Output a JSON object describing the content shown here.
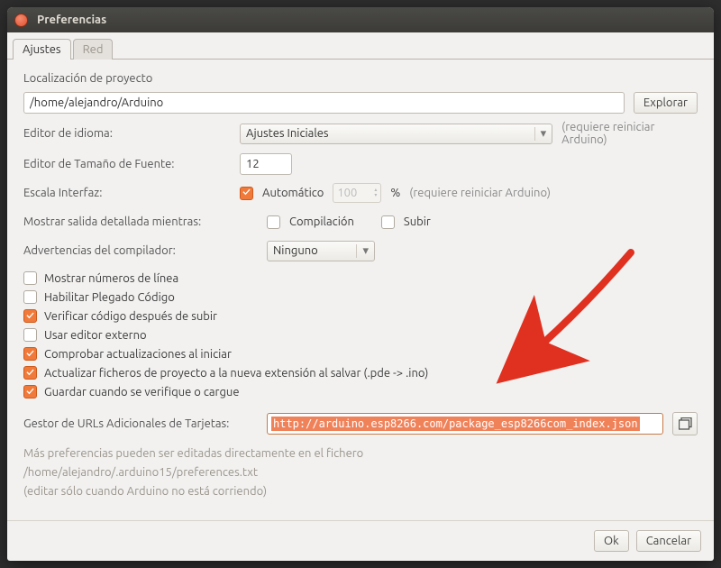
{
  "window": {
    "title": "Preferencias"
  },
  "tabs": {
    "active": "Ajustes",
    "other": "Red"
  },
  "project": {
    "label": "Localización de proyecto",
    "value": "/home/alejandro/Arduino",
    "browse": "Explorar"
  },
  "language": {
    "label": "Editor de idioma:",
    "value": "Ajustes Iniciales",
    "hint": "(requiere reiniciar Arduino)"
  },
  "fontsize": {
    "label": "Editor de Tamaño de Fuente:",
    "value": "12"
  },
  "scale": {
    "label": "Escala Interfaz:",
    "auto_label": "Automático",
    "auto_checked": true,
    "value": "100",
    "percent": "%",
    "hint": "(requiere reiniciar Arduino)"
  },
  "verbose": {
    "label": "Mostrar salida detallada mientras:",
    "compile_label": "Compilación",
    "compile_checked": false,
    "upload_label": "Subir",
    "upload_checked": false
  },
  "warnings": {
    "label": "Advertencias del compilador:",
    "value": "Ninguno"
  },
  "options": [
    {
      "label": "Mostrar números de línea",
      "checked": false
    },
    {
      "label": "Habilitar Plegado Código",
      "checked": false
    },
    {
      "label": "Verificar código después de subir",
      "checked": true
    },
    {
      "label": "Usar editor externo",
      "checked": false
    },
    {
      "label": "Comprobar actualizaciones al iniciar",
      "checked": true
    },
    {
      "label": "Actualizar ficheros de proyecto a la nueva extensión al salvar (.pde -> .ino)",
      "checked": true
    },
    {
      "label": "Guardar cuando se verifique o cargue",
      "checked": true
    }
  ],
  "boards_url": {
    "label": "Gestor de URLs Adicionales de Tarjetas:",
    "value": "http://arduino.esp8266.com/package_esp8266com_index.json"
  },
  "notes": {
    "line1": "Más preferencias pueden ser editadas directamente en el fichero",
    "line2": "/home/alejandro/.arduino15/preferences.txt",
    "line3": "(editar sólo cuando Arduino no está corriendo)"
  },
  "buttons": {
    "ok": "Ok",
    "cancel": "Cancelar"
  },
  "icons": {
    "close": "✕",
    "caret": "▾",
    "up": "▴",
    "down": "▾"
  }
}
